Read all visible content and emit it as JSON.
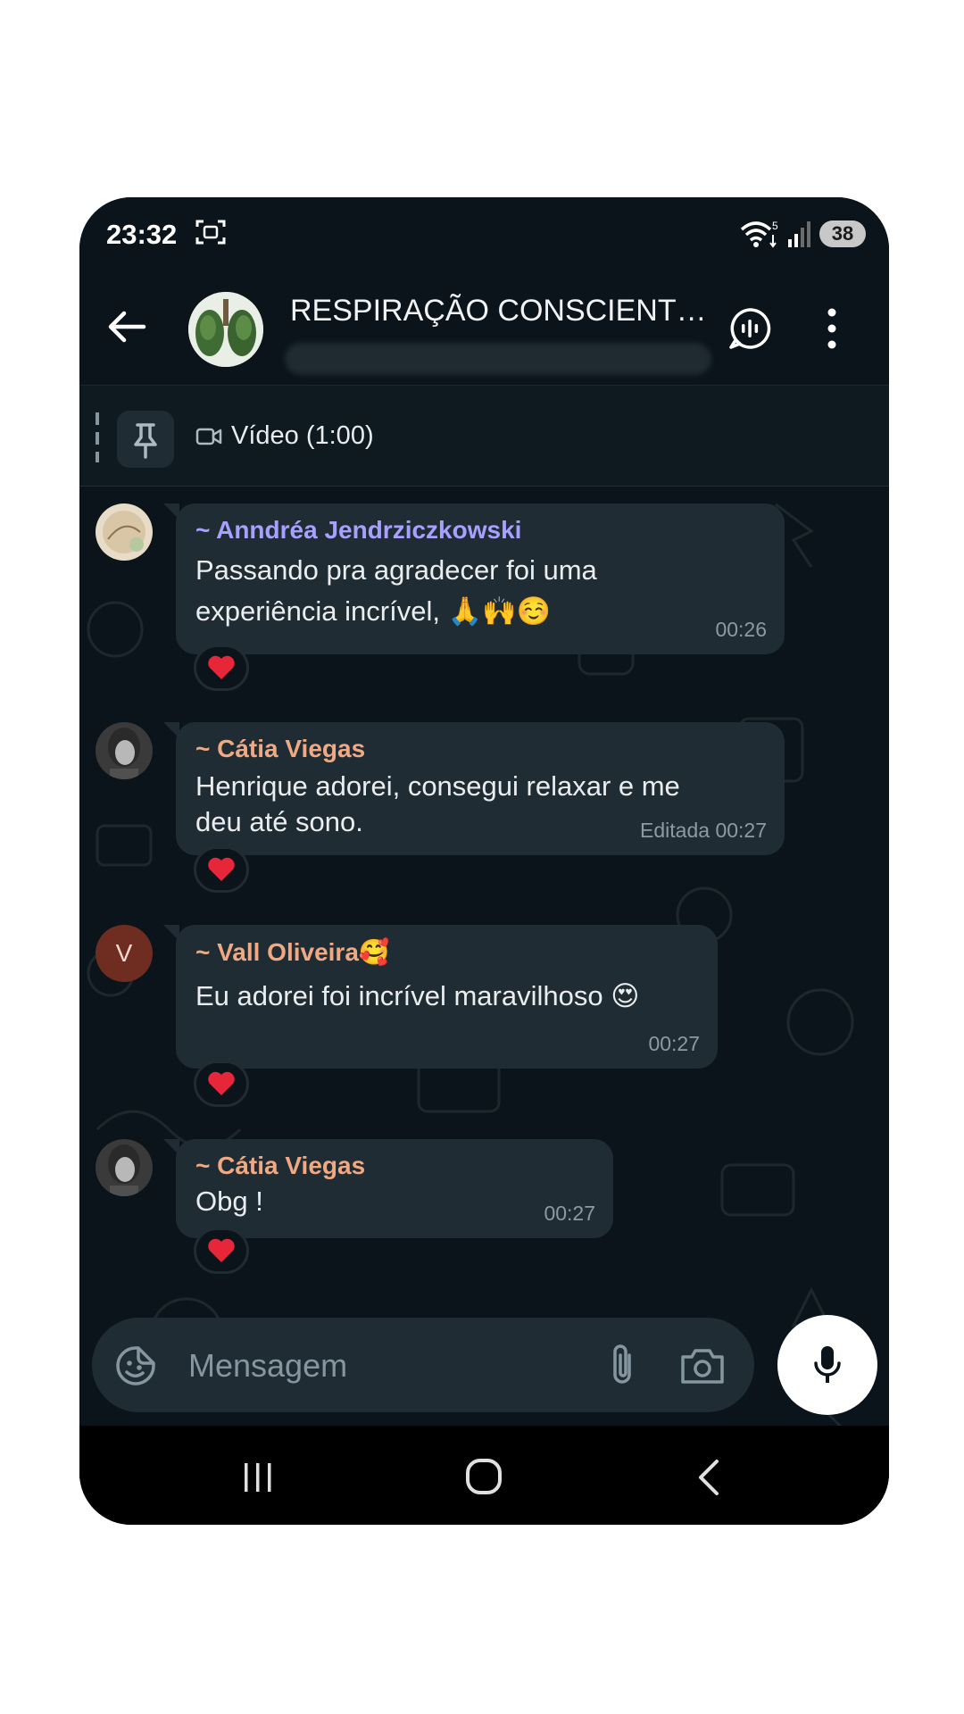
{
  "status_bar": {
    "time": "23:32",
    "battery": "38",
    "wifi_badge": "5"
  },
  "header": {
    "title": "RESPIRAÇÃO CONSCIENTE..."
  },
  "pinned": {
    "label": "Vídeo (1:00)"
  },
  "messages": [
    {
      "sender": "~ Anndréa Jendrziczkowski",
      "sender_color": "#a8a0ff",
      "text_line1": "Passando pra agradecer foi uma",
      "text_line2": "experiência incrível, 🙏🙌☺️",
      "time": "00:26",
      "reaction": "❤️"
    },
    {
      "sender": "~ Cátia Viegas",
      "sender_color": "#f0a982",
      "text_line1": "Henrique adorei, consegui relaxar e me",
      "text_line2": "deu até sono.",
      "edited": "Editada",
      "time": "00:27",
      "reaction": "❤️"
    },
    {
      "sender": "~ Vall Oliveira🥰",
      "sender_color": "#f0a982",
      "avatar_letter": "V",
      "text": "Eu adorei foi incrível maravilhoso 😍",
      "time": "00:27",
      "reaction": "❤️"
    },
    {
      "sender": "~ Cátia Viegas",
      "sender_color": "#f0a982",
      "text": "Obg !",
      "time": "00:27",
      "reaction": "❤️"
    }
  ],
  "composer": {
    "placeholder": "Mensagem"
  },
  "colors": {
    "background": "#0b141a",
    "bubble": "#202c33",
    "meta": "#8c9aa3",
    "accent_mic": "#ffffff"
  }
}
